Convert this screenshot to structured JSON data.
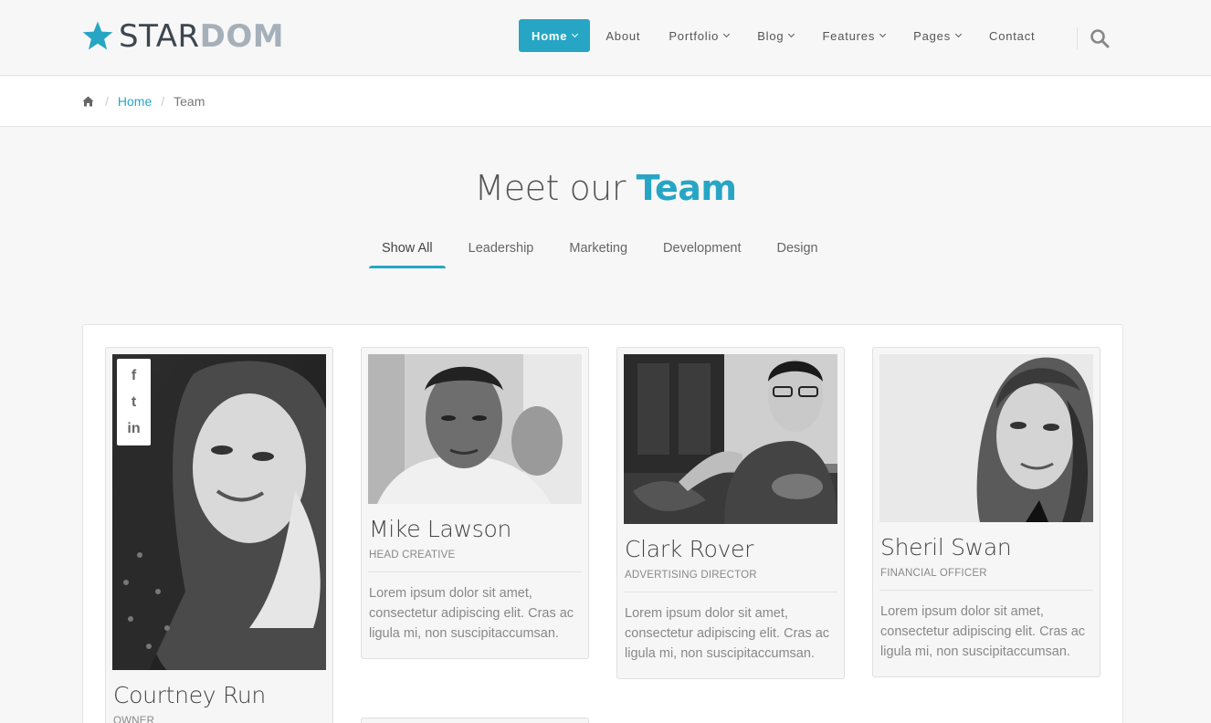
{
  "brand": {
    "part1": "STAR",
    "part2": "DOM"
  },
  "nav": {
    "items": [
      {
        "label": "Home",
        "dropdown": true
      },
      {
        "label": "About",
        "dropdown": false
      },
      {
        "label": "Portfolio",
        "dropdown": true
      },
      {
        "label": "Blog",
        "dropdown": true
      },
      {
        "label": "Features",
        "dropdown": true
      },
      {
        "label": "Pages",
        "dropdown": true
      },
      {
        "label": "Contact",
        "dropdown": false
      }
    ]
  },
  "breadcrumb": {
    "home_label": "Home",
    "current": "Team"
  },
  "page_title": {
    "plain": "Meet our ",
    "accent": "Team"
  },
  "filters": [
    "Show All",
    "Leadership",
    "Marketing",
    "Development",
    "Design"
  ],
  "team": [
    {
      "name": "Courtney Run",
      "role": "OWNER",
      "desc": "",
      "social": [
        "f",
        "t",
        "in"
      ]
    },
    {
      "name": "Mike Lawson",
      "role": "HEAD CREATIVE",
      "desc": "Lorem ipsum dolor sit amet, consectetur adipiscing elit. Cras ac ligula mi, non suscipitaccumsan."
    },
    {
      "name": "Clark Rover",
      "role": "ADVERTISING DIRECTOR",
      "desc": "Lorem ipsum dolor sit amet, consectetur adipiscing elit. Cras ac ligula mi, non suscipitaccumsan."
    },
    {
      "name": "Sheril Swan",
      "role": "FINANCIAL OFFICER",
      "desc": "Lorem ipsum dolor sit amet, consectetur adipiscing elit. Cras ac ligula mi, non suscipitaccumsan."
    }
  ],
  "colors": {
    "accent": "#26a6c4",
    "text": "#555555",
    "muted": "#888888"
  }
}
